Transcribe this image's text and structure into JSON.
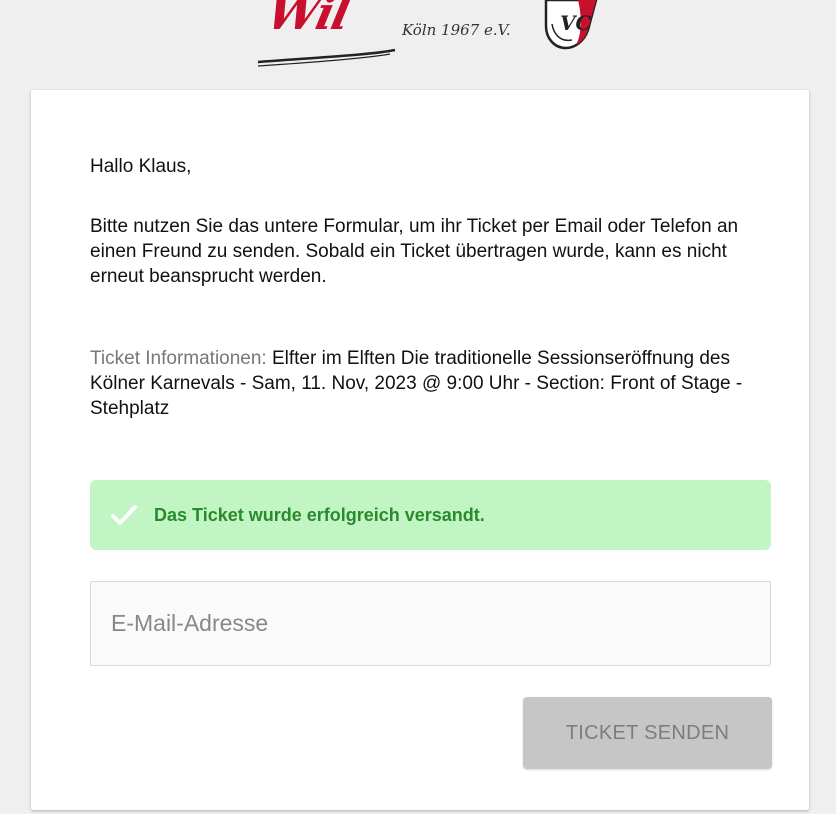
{
  "header": {
    "logo_script_text": "Wil",
    "logo_sub_text": "Köln 1967 e.V.",
    "logo_badge_text": "VC"
  },
  "card": {
    "greeting": "Hallo Klaus,",
    "intro": "Bitte nutzen Sie das untere Formular, um ihr Ticket per Email oder Telefon an einen Freund zu senden. Sobald ein Ticket übertragen wurde, kann es nicht erneut beansprucht werden.",
    "ticket_info_label": "Ticket Informationen: ",
    "ticket_info_value": "Elfter im Elften Die traditionelle Sessionseröffnung des Kölner Karnevals - Sam, 11. Nov, 2023 @ 9:00 Uhr - Section: Front of Stage - Stehplatz",
    "success_alert": {
      "icon": "checkmark-icon",
      "text": "Das Ticket wurde erfolgreich versandt."
    },
    "email_input": {
      "value": "",
      "placeholder": "E-Mail-Adresse"
    },
    "send_button_label": "TICKET SENDEN"
  },
  "colors": {
    "background": "#efefef",
    "card": "#ffffff",
    "brand_red": "#c8102e",
    "alert_bg": "#c2f5c4",
    "alert_text": "#2a8a2e",
    "button_disabled_bg": "#c6c6c6",
    "button_disabled_text": "#7d7d7d"
  }
}
